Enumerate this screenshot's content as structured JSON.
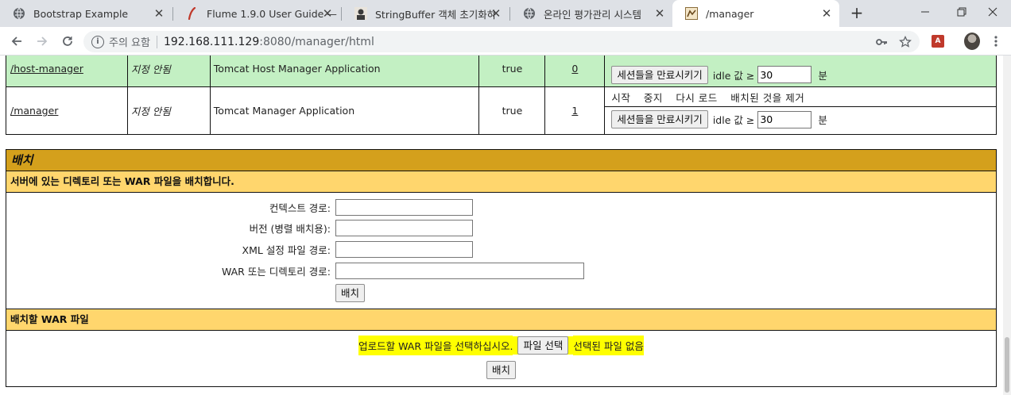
{
  "browser": {
    "tabs": [
      {
        "title": "Bootstrap Example",
        "icon": "globe-icon",
        "active": false
      },
      {
        "title": "Flume 1.9.0 User Guide —",
        "icon": "feather-icon",
        "active": false
      },
      {
        "title": "StringBuffer 객체 초기화하",
        "icon": "avatar-icon",
        "active": false
      },
      {
        "title": "온라인 평가관리 시스템",
        "icon": "globe-icon",
        "active": false
      },
      {
        "title": "/manager",
        "icon": "tomcat-icon",
        "active": true
      }
    ],
    "security_label": "주의 요함",
    "url_host": "192.168.111.129",
    "url_rest": ":8080/manager/html"
  },
  "apps": {
    "rows": [
      {
        "path": "/host-manager",
        "version": "지정 안됨",
        "name": "Tomcat Host Manager Application",
        "running": "true",
        "sessions": "0",
        "commands": [],
        "highlighted": true
      },
      {
        "path": "/manager",
        "version": "지정 안됨",
        "name": "Tomcat Manager Application",
        "running": "true",
        "sessions": "1",
        "commands": [
          "시작",
          "중지",
          "다시 로드",
          "배치된 것을 제거"
        ],
        "highlighted": false
      }
    ],
    "expire_button": "세션들을 만료시키기",
    "idle_label": "idle 값 ≥",
    "idle_value": "30",
    "idle_unit": "분"
  },
  "deploy": {
    "title": "배치",
    "server_heading": "서버에 있는 디렉토리 또는 WAR 파일을 배치합니다.",
    "fields": [
      {
        "label": "컨텍스트 경로:",
        "value": ""
      },
      {
        "label": "버전 (병렬 배치용):",
        "value": ""
      },
      {
        "label": "XML 설정 파일 경로:",
        "value": ""
      },
      {
        "label": "WAR 또는 디렉토리 경로:",
        "value": ""
      }
    ],
    "deploy_button": "배치",
    "war_heading": "배치할 WAR 파일",
    "upload_label": "업로드할 WAR 파일을 선택하십시오.",
    "file_button": "파일 선택",
    "no_file": "선택된 파일 없음",
    "war_deploy_button": "배치"
  }
}
